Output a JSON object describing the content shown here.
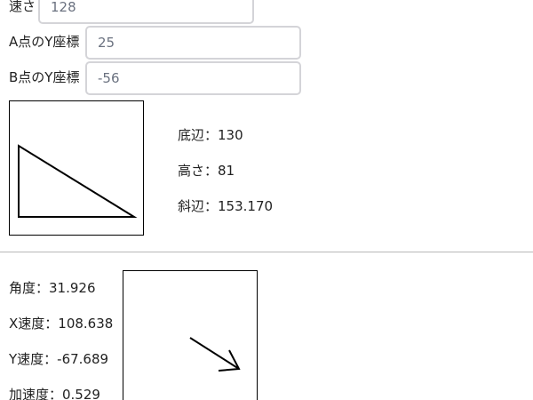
{
  "inputs": {
    "speed": {
      "label": "速さ",
      "value": "128"
    },
    "a_y": {
      "label": "A点のY座標",
      "value": "25"
    },
    "b_y": {
      "label": "B点のY座標",
      "value": "-56"
    }
  },
  "triangle": {
    "base_label": "底辺：130",
    "height_label": "高さ：81",
    "hypotenuse_label": "斜辺：153.170"
  },
  "motion": {
    "angle_label": "角度：31.926",
    "vx_label": "X速度：108.638",
    "vy_label": "Y速度：-67.689",
    "accel_label": "加速度：0.529"
  }
}
